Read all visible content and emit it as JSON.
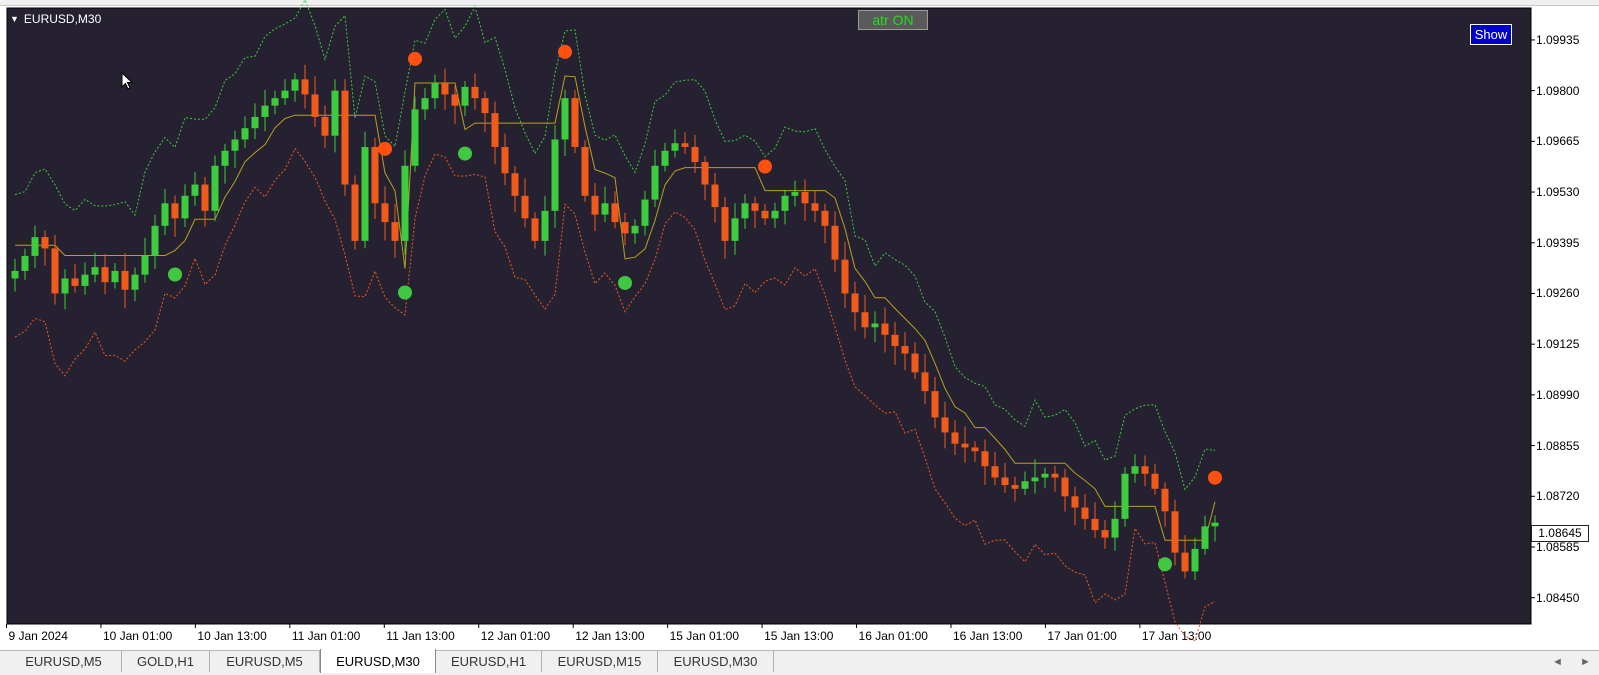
{
  "window": {
    "symbol_label": "EURUSD,M30",
    "atr_button_label": "atr ON",
    "show_button_label": "Show",
    "current_price": "1.08645"
  },
  "colors": {
    "background": "#262130",
    "bull": "#3dcc3d",
    "bear": "#f05a1a",
    "trend_line": "#b8a020",
    "upper_band": "#3dcc3d",
    "lower_band": "#f05a1a",
    "sell_dot": "#ff5010",
    "buy_dot": "#40c840"
  },
  "tabs": [
    {
      "label": "EURUSD,M5",
      "active": false
    },
    {
      "label": "GOLD,H1",
      "active": false
    },
    {
      "label": "EURUSD,M5",
      "active": false
    },
    {
      "label": "EURUSD,M30",
      "active": true
    },
    {
      "label": "EURUSD,H1",
      "active": false
    },
    {
      "label": "EURUSD,M15",
      "active": false
    },
    {
      "label": "EURUSD,M30",
      "active": false
    }
  ],
  "icons": {
    "scroll_left": "◄",
    "scroll_right": "►",
    "symbol_menu": "▼"
  },
  "chart_data": {
    "type": "candlestick",
    "symbol": "EURUSD",
    "timeframe": "M30",
    "y_ticks": [
      "1.09935",
      "1.09800",
      "1.09665",
      "1.09530",
      "1.09395",
      "1.09260",
      "1.09125",
      "1.08990",
      "1.08855",
      "1.08720",
      "1.08585",
      "1.08450"
    ],
    "ylim": [
      1.0838,
      1.1002
    ],
    "x_ticks": [
      "9 Jan 2024",
      "10 Jan 01:00",
      "10 Jan 13:00",
      "11 Jan 01:00",
      "11 Jan 13:00",
      "12 Jan 01:00",
      "12 Jan 13:00",
      "15 Jan 01:00",
      "15 Jan 13:00",
      "16 Jan 01:00",
      "16 Jan 13:00",
      "17 Jan 01:00",
      "17 Jan 13:00"
    ],
    "grid": false,
    "series": [
      {
        "name": "close",
        "values": [
          1.0932,
          1.0936,
          1.0941,
          1.0938,
          1.0926,
          1.093,
          1.0928,
          1.0931,
          1.0933,
          1.0929,
          1.0932,
          1.0927,
          1.0931,
          1.0936,
          1.0944,
          1.095,
          1.0946,
          1.0952,
          1.0955,
          1.0948,
          1.096,
          1.0964,
          1.0967,
          1.097,
          1.0973,
          1.0976,
          1.0978,
          1.098,
          1.0983,
          1.0979,
          1.0973,
          1.0968,
          1.098,
          1.0955,
          1.094,
          1.0965,
          1.095,
          1.0945,
          1.094,
          1.096,
          1.0975,
          1.0978,
          1.0982,
          1.0979,
          1.0976,
          1.0981,
          1.0978,
          1.0974,
          1.0965,
          1.0958,
          1.0952,
          1.0946,
          1.094,
          1.0948,
          1.0967,
          1.0978,
          1.0965,
          1.0952,
          1.0947,
          1.095,
          1.0945,
          1.0942,
          1.0944,
          1.0951,
          1.096,
          1.0964,
          1.0966,
          1.0965,
          1.0961,
          1.0955,
          1.0949,
          1.094,
          1.0946,
          1.095,
          1.0948,
          1.0946,
          1.0948,
          1.0952,
          1.0953,
          1.095,
          1.0948,
          1.0944,
          1.0935,
          1.0926,
          1.0921,
          1.0917,
          1.0918,
          1.0915,
          1.0912,
          1.091,
          1.0905,
          1.09,
          1.0893,
          1.0889,
          1.0886,
          1.0885,
          1.0884,
          1.088,
          1.0877,
          1.0875,
          1.0874,
          1.0876,
          1.0877,
          1.0878,
          1.0877,
          1.0872,
          1.0869,
          1.0866,
          1.0863,
          1.0861,
          1.0866,
          1.0878,
          1.088,
          1.0878,
          1.0874,
          1.0868,
          1.0857,
          1.0852,
          1.0858,
          1.0864,
          1.0865
        ]
      }
    ],
    "signals": [
      {
        "type": "buy",
        "index": 16
      },
      {
        "type": "sell",
        "index": 37
      },
      {
        "type": "buy",
        "index": 39
      },
      {
        "type": "sell",
        "index": 40
      },
      {
        "type": "buy",
        "index": 45
      },
      {
        "type": "sell",
        "index": 55
      },
      {
        "type": "buy",
        "index": 61
      },
      {
        "type": "sell",
        "index": 75
      },
      {
        "type": "buy",
        "index": 115
      },
      {
        "type": "sell",
        "index": 120
      }
    ]
  }
}
